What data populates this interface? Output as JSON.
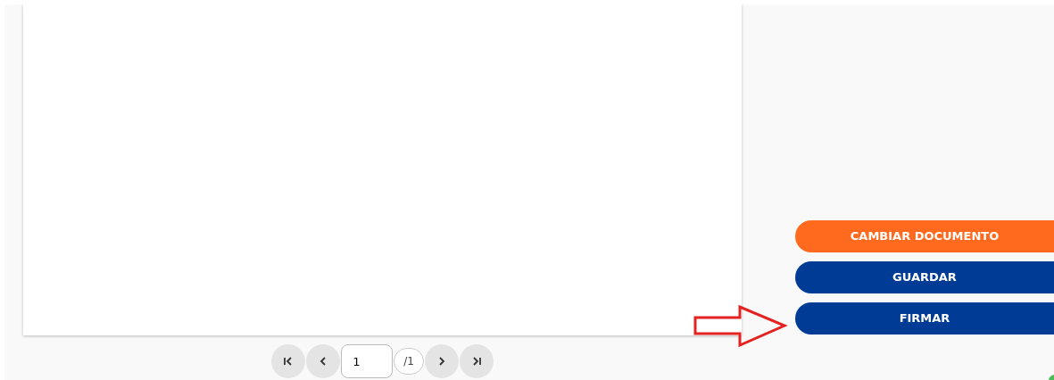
{
  "pager": {
    "page_value": "1",
    "total": "/1"
  },
  "actions": [
    {
      "label": "CAMBIAR DOCUMENTO",
      "kind": "secondary"
    },
    {
      "label": "GUARDAR",
      "kind": "primary"
    },
    {
      "label": "FIRMAR",
      "kind": "primary"
    }
  ]
}
